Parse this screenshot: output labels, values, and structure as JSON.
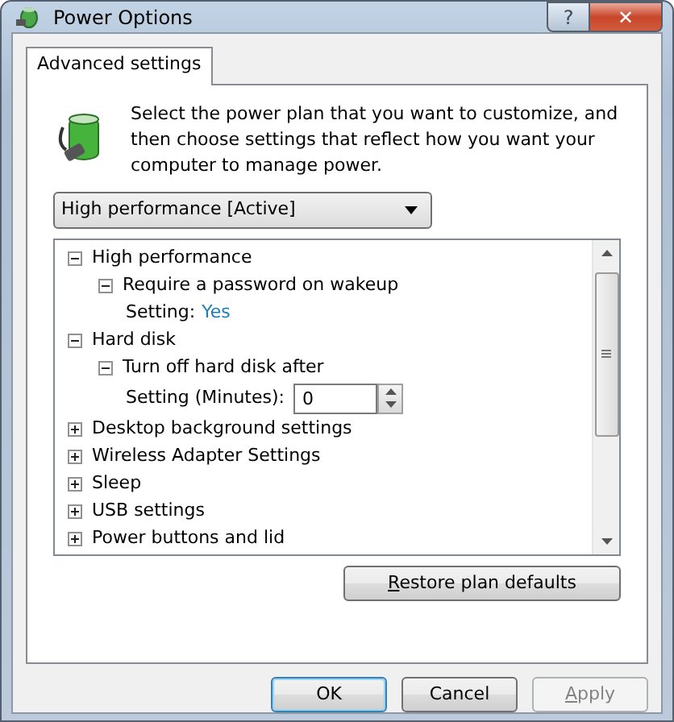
{
  "window": {
    "title": "Power Options",
    "controls": [
      "?",
      "✕"
    ]
  },
  "tabs": [
    {
      "label": "Advanced settings",
      "selected": true
    }
  ],
  "intro": "Select the power plan that you want to customize, and then choose settings that reflect how you want your computer to manage power.",
  "plan_dropdown": {
    "value": "High performance [Active]"
  },
  "tree": [
    {
      "label": "High performance",
      "expanded": true,
      "children": [
        {
          "label": "Require a password on wakeup",
          "expanded": true,
          "children": [
            {
              "kind": "value",
              "label": "Setting:",
              "value": "Yes"
            }
          ]
        }
      ]
    },
    {
      "label": "Hard disk",
      "expanded": true,
      "children": [
        {
          "label": "Turn off hard disk after",
          "expanded": true,
          "children": [
            {
              "kind": "spin",
              "label": "Setting (Minutes):",
              "value": "0"
            }
          ]
        }
      ]
    },
    {
      "label": "Desktop background settings",
      "expanded": false
    },
    {
      "label": "Wireless Adapter Settings",
      "expanded": false
    },
    {
      "label": "Sleep",
      "expanded": false
    },
    {
      "label": "USB settings",
      "expanded": false
    },
    {
      "label": "Power buttons and lid",
      "expanded": false
    }
  ],
  "restore_button": {
    "label": "Restore plan defaults",
    "mnemonic": true
  },
  "buttons": [
    {
      "label": "OK",
      "default": true,
      "disabled": false,
      "mnemonic": false
    },
    {
      "label": "Cancel",
      "default": false,
      "disabled": false,
      "mnemonic": false
    },
    {
      "label": "Apply",
      "default": false,
      "disabled": true,
      "mnemonic": true
    }
  ]
}
